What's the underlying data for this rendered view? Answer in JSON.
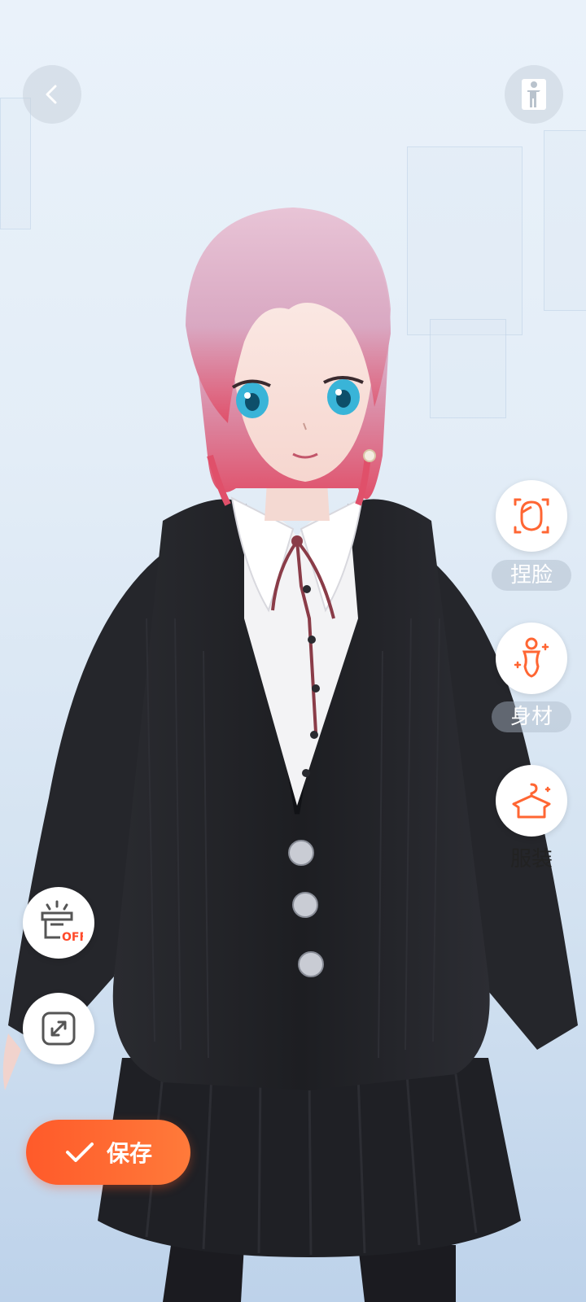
{
  "accent_color": "#ff6633",
  "header": {
    "back_icon": "chevron-left-icon",
    "body_view_icon": "standing-person-icon"
  },
  "side_menu": {
    "items": [
      {
        "label": "捏脸",
        "icon": "face-icon",
        "active": false
      },
      {
        "label": "身材",
        "icon": "body-shape-icon",
        "active": false
      },
      {
        "label": "服装",
        "icon": "clothes-hanger-icon",
        "active": true
      }
    ]
  },
  "tools": {
    "lighting_icon": "lamp-off-icon",
    "lighting_badge": "OFF",
    "expand_icon": "expand-icon"
  },
  "footer": {
    "save_label": "保存",
    "save_icon": "checkmark-icon"
  }
}
